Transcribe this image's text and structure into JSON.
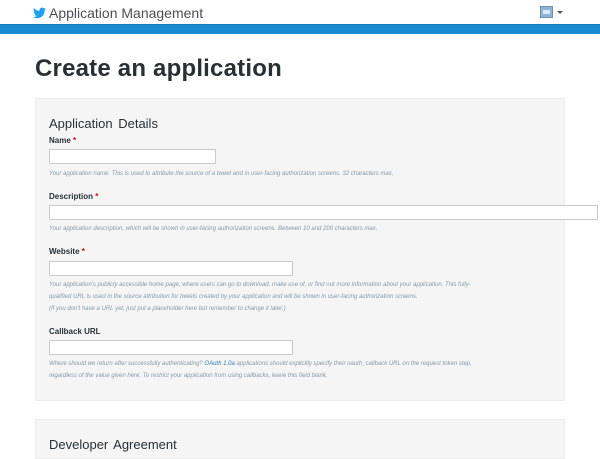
{
  "header": {
    "app_title": "Application Management",
    "brand_icon": "twitter-bird-icon",
    "avatar_icon": "user-avatar-icon",
    "accent_color": "#1a8bd0"
  },
  "page": {
    "title": "Create an application"
  },
  "details": {
    "section_title": "Application Details",
    "fields": {
      "name": {
        "label": "Name",
        "required_mark": "*",
        "value": "",
        "help": "Your application name. This is used to attribute the source of a tweet and in user-facing authorization screens. 32 characters max."
      },
      "description": {
        "label": "Description",
        "required_mark": "*",
        "value": "",
        "help": "Your application description, which will be shown in user-facing authorization screens. Between 10 and 200 characters max."
      },
      "website": {
        "label": "Website",
        "required_mark": "*",
        "value": "",
        "help_line1": "Your application's publicly accessible home page, where users can go to download, make use of, or find out more information about your application. This fully-",
        "help_line2": "qualified URL is used in the source attribution for tweets created by your application and will be shown in user-facing authorization screens.",
        "help_line3": "(If you don't have a URL yet, just put a placeholder here but remember to change it later.)"
      },
      "callback": {
        "label": "Callback URL",
        "value": "",
        "help_pre": "Where should we return after successfully authenticating?",
        "help_link": "OAuth 1.0a",
        "help_post": "applications should explicitly specify their oauth_callback URL on the request token step,",
        "help_line2": "regardless of the value given here. To restrict your application from using callbacks, leave this field blank."
      }
    }
  },
  "agreement": {
    "section_title": "Developer Agreement"
  }
}
